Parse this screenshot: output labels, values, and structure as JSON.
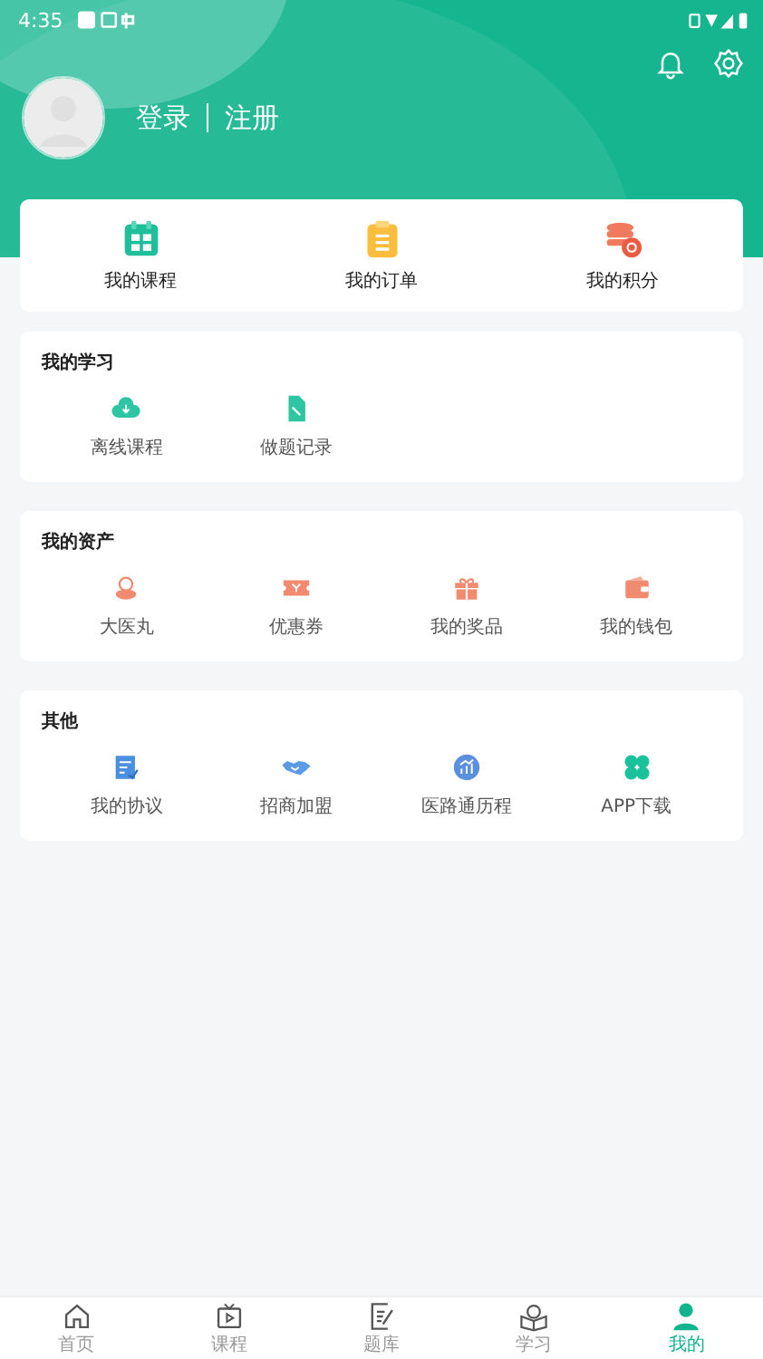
{
  "status_bar": {
    "time": "4:35"
  },
  "header": {
    "login": "登录",
    "register": "注册"
  },
  "quick_links": [
    {
      "label": "我的课程"
    },
    {
      "label": "我的订单"
    },
    {
      "label": "我的积分"
    }
  ],
  "sections": [
    {
      "title": "我的学习",
      "items": [
        {
          "label": "离线课程"
        },
        {
          "label": "做题记录"
        }
      ]
    },
    {
      "title": "我的资产",
      "items": [
        {
          "label": "大医丸"
        },
        {
          "label": "优惠券"
        },
        {
          "label": "我的奖品"
        },
        {
          "label": "我的钱包"
        }
      ]
    },
    {
      "title": "其他",
      "items": [
        {
          "label": "我的协议"
        },
        {
          "label": "招商加盟"
        },
        {
          "label": "医路通历程"
        },
        {
          "label": "APP下载"
        }
      ]
    }
  ],
  "tab_bar": [
    {
      "label": "首页",
      "selected": false
    },
    {
      "label": "课程",
      "selected": false
    },
    {
      "label": "题库",
      "selected": false
    },
    {
      "label": "学习",
      "selected": false
    },
    {
      "label": "我的",
      "selected": true
    }
  ]
}
